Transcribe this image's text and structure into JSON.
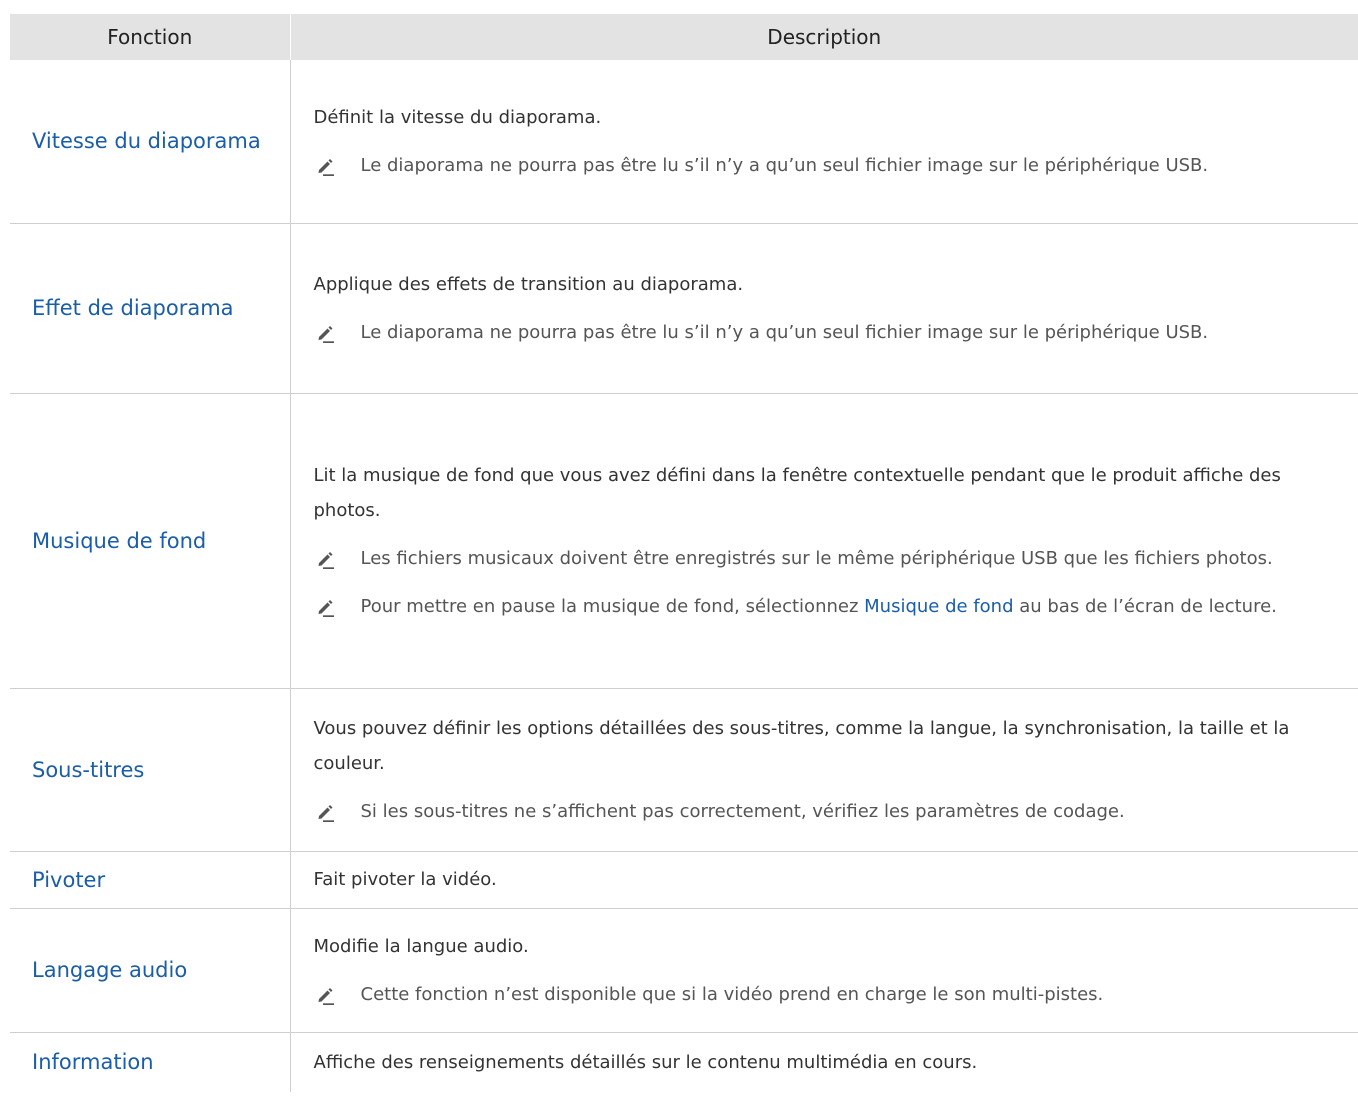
{
  "header": {
    "col_function": "Fonction",
    "col_description": "Description"
  },
  "rows": [
    {
      "function": "Vitesse du diaporama",
      "description": "Définit la vitesse du diaporama.",
      "notes": [
        "Le diaporama ne pourra pas être lu s’il n’y a qu’un seul fichier image sur le périphérique USB."
      ]
    },
    {
      "function": "Effet de diaporama",
      "description": "Applique des effets de transition au diaporama.",
      "notes": [
        "Le diaporama ne pourra pas être lu s’il n’y a qu’un seul fichier image sur le périphérique USB."
      ]
    },
    {
      "function": "Musique de fond",
      "description": "Lit la musique de fond que vous avez défini dans la fenêtre contextuelle pendant que le produit affiche des photos.",
      "notes": [
        "Les fichiers musicaux doivent être enregistrés sur le même périphérique USB que les fichiers photos."
      ],
      "note_rich": {
        "before": "Pour mettre en pause la musique de fond, sélectionnez ",
        "highlight": "Musique de fond",
        "after": " au bas de l’écran de lecture."
      }
    },
    {
      "function": "Sous-titres",
      "description": "Vous pouvez définir les options détaillées des sous-titres, comme la langue, la synchronisation, la taille et la couleur.",
      "notes": [
        "Si les sous-titres ne s’affichent pas correctement, vérifiez les paramètres de codage."
      ]
    },
    {
      "function": "Pivoter",
      "description": "Fait pivoter la vidéo.",
      "notes": []
    },
    {
      "function": "Langage audio",
      "description": "Modifie la langue audio.",
      "notes": [
        "Cette fonction n’est disponible que si la vidéo prend en charge le son multi-pistes."
      ]
    },
    {
      "function": "Information",
      "description": "Affiche des renseignements détaillés sur le contenu multimédia en cours.",
      "notes": []
    }
  ],
  "icons": {
    "note": "pencil-icon"
  },
  "colors": {
    "accent": "#1a5da8",
    "header_bg": "#e3e3e3",
    "text": "#333333",
    "border": "#cfcfcf"
  }
}
